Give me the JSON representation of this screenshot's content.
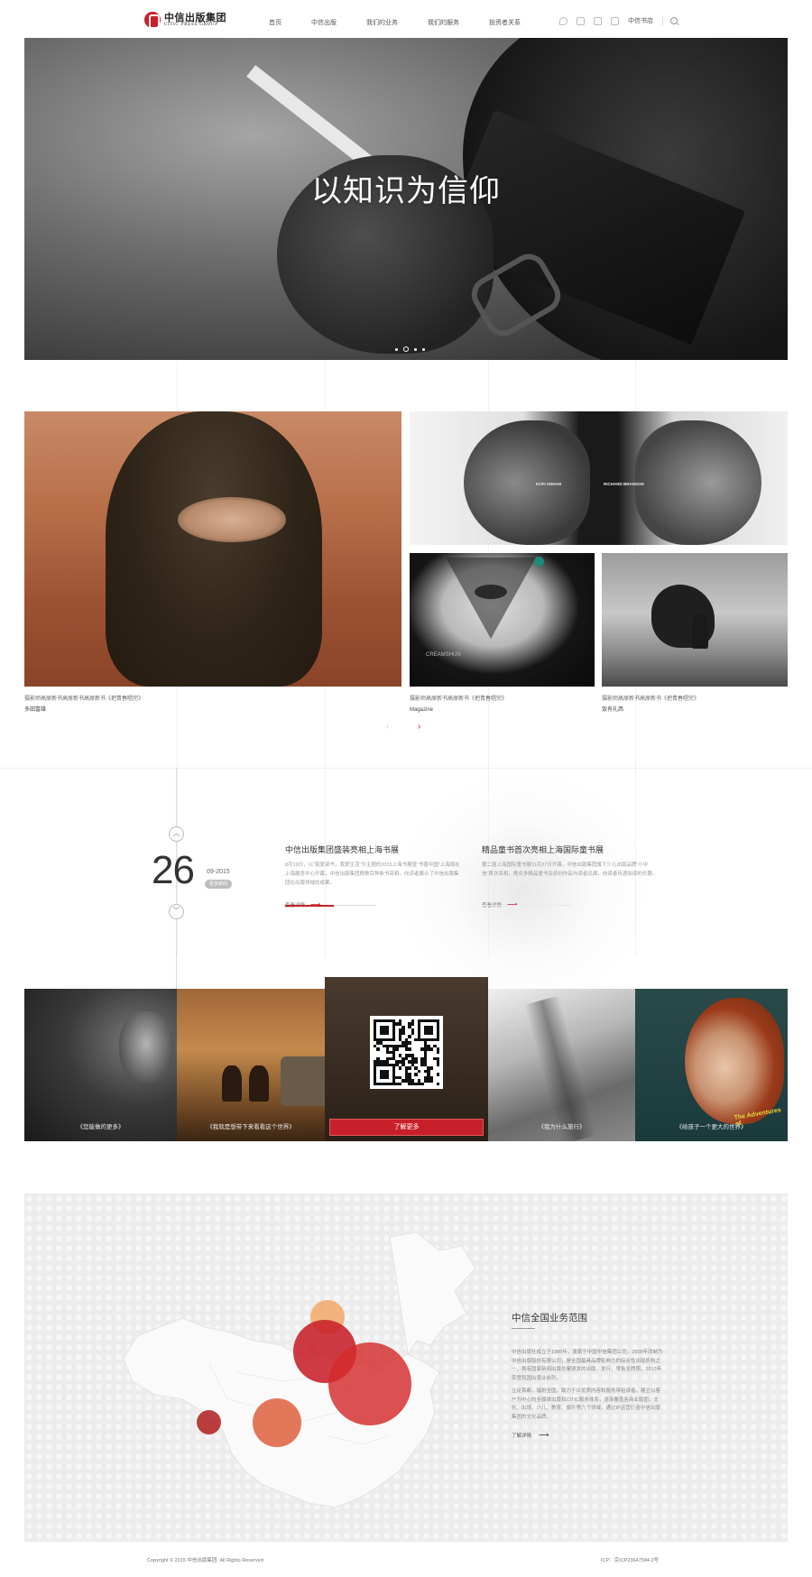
{
  "header": {
    "logo_cn": "中信出版集团",
    "logo_en": "CITIC PRESS GROUP",
    "nav": [
      "首页",
      "中信出版",
      "我们的业务",
      "我们的服务",
      "投资者关系"
    ],
    "store_label": "中信书店",
    "tool_icons": [
      "phone-icon",
      "edit-icon",
      "doc-icon",
      "book-icon",
      "search-icon"
    ]
  },
  "hero": {
    "title": "以知识为信仰",
    "slides": 4,
    "active_slide": 2
  },
  "gallery": {
    "items": [
      {
        "caption": "摄影师高原新书高原新书高原新书《把青春唱完》",
        "sub": "多田富雄"
      },
      {
        "caption": "摄影师高原新书高原新书《把青春唱完》",
        "sub": "Magazine"
      },
      {
        "caption": "摄影师高原新书高原新书《把青春唱完》",
        "sub": "饭有礼西"
      }
    ],
    "faces_labels": [
      "KOFI ANNAN",
      "RICHARD BRANSON"
    ],
    "tattoo_brand": "CREAMSHUN",
    "prev_icon": "‹",
    "next_icon": "›"
  },
  "news": {
    "day": "26",
    "year_month": "09-2015",
    "badge": "更多新闻",
    "up_icon": "︿",
    "down_icon": "﹀",
    "items": [
      {
        "title": "中信出版集团盛装亮相上海书展",
        "body": "8月19日，以“我爱读书，我爱生活”为主题的2015上海书展暨“书香中国”上海周在上海展览中心开幕，中信出版集团携数百种新书亮相，向读者展示了中信出版集团在出版领域的成果。",
        "more": "查看详情"
      },
      {
        "title": "精品童书首次亮相上海国际童书展",
        "body": "第二届上海国际童书展11月27日开幕，中信出版集团旗下少儿出版品牌“小中信”首次亮相，携众多精品童书及原创作品与读者见面，向读者传递阅读的乐趣。",
        "more": "查看详情"
      }
    ]
  },
  "books": {
    "items": [
      "《您能做的更多》",
      "《我就是想带下来看看这个世界》",
      "",
      "《我为什么旅行》",
      "《给孩子一个更大的世界》"
    ],
    "qr_button": "了解更多",
    "magazine_text": "The Adventures of"
  },
  "map": {
    "title": "中信全国业务范围",
    "p1": "中信出版社成立于1988年，隶属于中国中信集团公司，2008年改制为中信出版股份有限公司，是全国最具品牌影响力的综合性出版机构之一，拥有国家新闻出版总署颁发的出版、发行、零售全牌照，2013年荣登我国出版业前列。",
    "p2": "立足首都，辐射全国，致力于以优质内容和服务带给读者，建立以客户为中心的全媒体出版和CITIC服务体系，逐渐覆盖各商业版图，文化、出境、少儿、教育、娱乐等六个领域，通过IP运营打造中信出版集团的文化品牌。",
    "more": "了解详情",
    "bubbles": [
      {
        "name": "bubble-north",
        "color": "#f2a86a"
      },
      {
        "name": "bubble-central",
        "color": "#c8202a"
      },
      {
        "name": "bubble-east",
        "color": "#d42b2b"
      },
      {
        "name": "bubble-south",
        "color": "#e06848"
      },
      {
        "name": "bubble-west",
        "color": "#b52a2a"
      }
    ]
  },
  "footer": {
    "copyright": "Copyright © 2015 中信出版集团. All Rights Reserved",
    "icp": "ICP：京ICP23647584-2号"
  },
  "colors": {
    "brand_red": "#c8202a",
    "orange": "#e06848",
    "peach": "#f2a86a"
  }
}
